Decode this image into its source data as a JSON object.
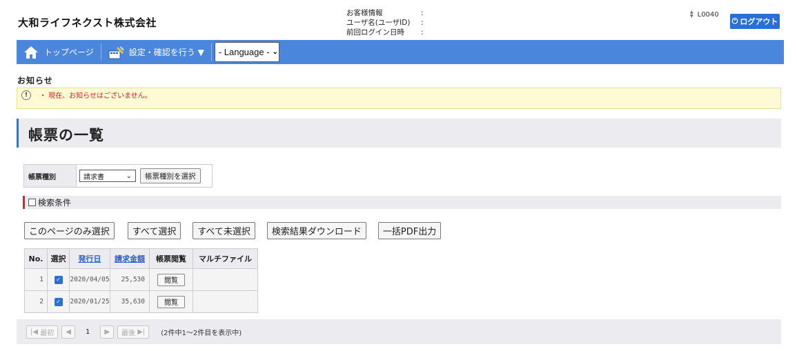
{
  "header": {
    "company": "大和ライフネクスト株式会社",
    "customer_info": [
      {
        "label": "お客様情報",
        "colon": ":"
      },
      {
        "label": "ユーザ名(ユーザID)",
        "colon": ":"
      },
      {
        "label": "前回ログイン日時",
        "colon": ":"
      }
    ],
    "user_code": "L0040",
    "logout_label": "ログアウト"
  },
  "nav": {
    "top_page": "トップページ",
    "settings": "設定・確認を行う ▼",
    "language": "- Language -"
  },
  "notice": {
    "title": "お知らせ",
    "icon": "!",
    "text": "・ 現在、お知らせはございません。"
  },
  "page_title": "帳票の一覧",
  "form_type": {
    "label": "帳票種別",
    "selected": "請求書",
    "button": "帳票種別を選択"
  },
  "search": {
    "label": "検索条件"
  },
  "actions": {
    "select_page": "このページのみ選択",
    "select_all": "すべて選択",
    "deselect_all": "すべて未選択",
    "download": "検索結果ダウンロード",
    "bulk_pdf": "一括PDF出力"
  },
  "table": {
    "headers": {
      "no": "No.",
      "select": "選択",
      "issue_date": "発行日",
      "amount": "請求金額",
      "view": "帳票閲覧",
      "multi": "マルチファイル"
    },
    "rows": [
      {
        "no": "1",
        "date": "2020/04/05",
        "amount": "25,530",
        "view": "閲覧"
      },
      {
        "no": "2",
        "date": "2020/01/25",
        "amount": "35,630",
        "view": "閲覧"
      }
    ]
  },
  "pager": {
    "first": "最初",
    "last": "最後",
    "page": "1",
    "info": "(2件中1～2件目を表示中)"
  },
  "colors": {
    "nav": "#4b86dd",
    "logout": "#2a6fd6",
    "notice_bg": "#fefbd4",
    "notice_text": "#dd2222"
  }
}
